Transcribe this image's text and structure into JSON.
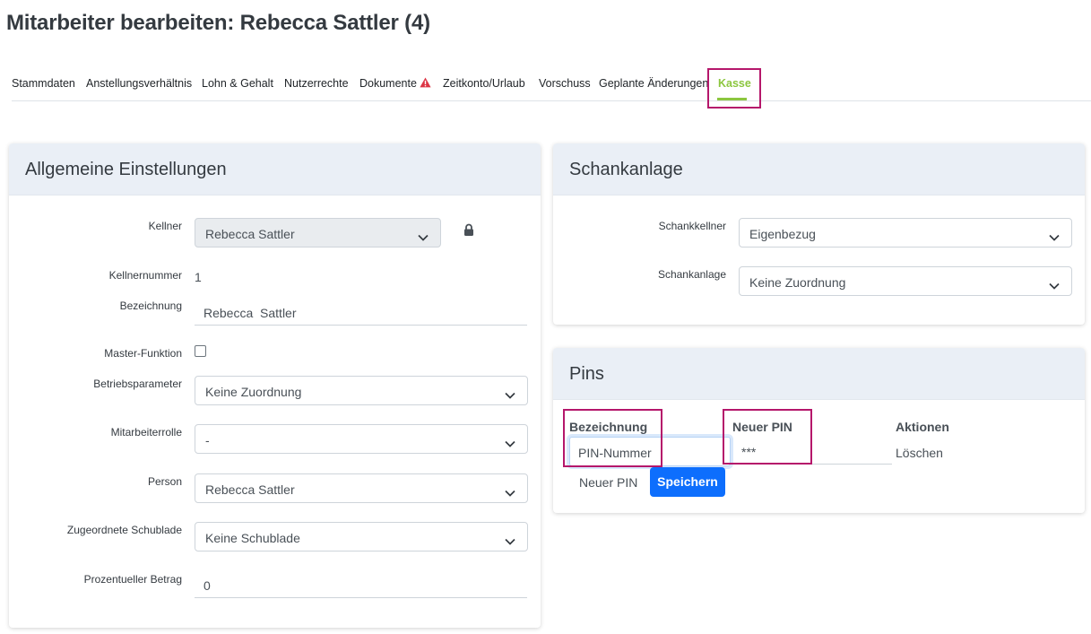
{
  "page": {
    "title": "Mitarbeiter bearbeiten: Rebecca Sattler (4)"
  },
  "tabs": [
    {
      "label": "Stammdaten"
    },
    {
      "label": "Anstellungsverhältnis"
    },
    {
      "label": "Lohn & Gehalt"
    },
    {
      "label": "Nutzerrechte"
    },
    {
      "label": "Dokumente",
      "icon": "warning-icon"
    },
    {
      "label": "Zeitkonto/Urlaub"
    },
    {
      "label": "Vorschuss"
    },
    {
      "label": "Geplante Änderungen"
    },
    {
      "label": "Kasse",
      "active": true
    }
  ],
  "colors": {
    "accent": "#8cc63f",
    "highlight": "#b5176b",
    "primary": "#0d6efd",
    "warning": "#dc3545"
  },
  "general": {
    "title": "Allgemeine Einstellungen",
    "kellner": {
      "label": "Kellner",
      "value": "Rebecca Sattler",
      "lock_icon": "lock-icon"
    },
    "kellnernummer": {
      "label": "Kellnernummer",
      "value": "1"
    },
    "bezeichnung": {
      "label": "Bezeichnung",
      "value": "Rebecca  Sattler"
    },
    "master": {
      "label": "Master-Funktion",
      "checked": false
    },
    "betriebsparameter": {
      "label": "Betriebsparameter",
      "value": "Keine Zuordnung"
    },
    "mitarbeiterrolle": {
      "label": "Mitarbeiterrolle",
      "value": "-"
    },
    "person": {
      "label": "Person",
      "value": "Rebecca Sattler"
    },
    "schublade": {
      "label": "Zugeordnete Schublade",
      "value": "Keine Schublade"
    },
    "prozent": {
      "label": "Prozentueller Betrag",
      "value": "0"
    }
  },
  "schankanlage": {
    "title": "Schankanlage",
    "schankkellner": {
      "label": "Schankkellner",
      "value": "Eigenbezug"
    },
    "schankanlage": {
      "label": "Schankanlage",
      "value": "Keine Zuordnung"
    }
  },
  "pins": {
    "title": "Pins",
    "columns": {
      "bezeichnung": "Bezeichnung",
      "neuer_pin": "Neuer PIN",
      "aktionen": "Aktionen"
    },
    "row": {
      "bezeichnung_placeholder": "PIN-Nummer",
      "pin_value": "***",
      "delete_label": "Löschen"
    },
    "new_pin_label": "Neuer PIN",
    "save_label": "Speichern"
  }
}
